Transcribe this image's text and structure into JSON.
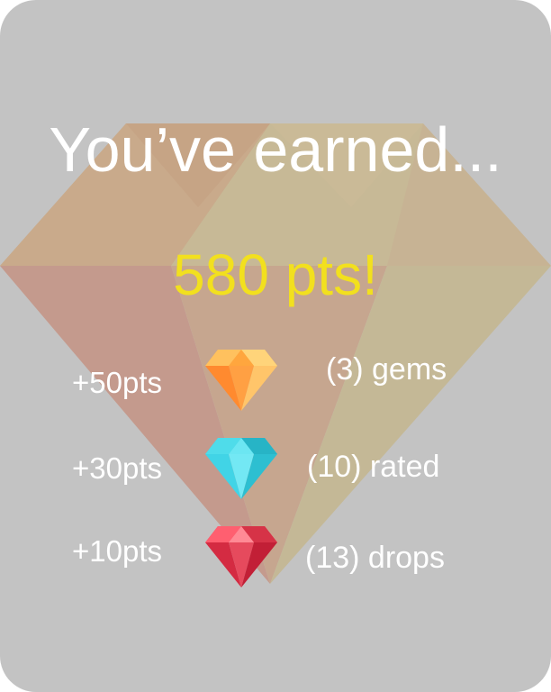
{
  "summary": {
    "title": "You’ve earned...",
    "total_points": "580 pts!"
  },
  "rewards": [
    {
      "points": "+50pts",
      "label": "(3) gems",
      "icon": "orange-gem-icon",
      "color": "#ff9a3c"
    },
    {
      "points": "+30pts",
      "label": "(10) rated",
      "icon": "cyan-gem-icon",
      "color": "#3fd6e6"
    },
    {
      "points": "+10pts",
      "label": "(13) drops",
      "icon": "red-gem-icon",
      "color": "#e3334c"
    }
  ],
  "colors": {
    "card_background": "#c3c3c3",
    "title_text": "#ffffff",
    "points_text": "#f2e01e"
  }
}
